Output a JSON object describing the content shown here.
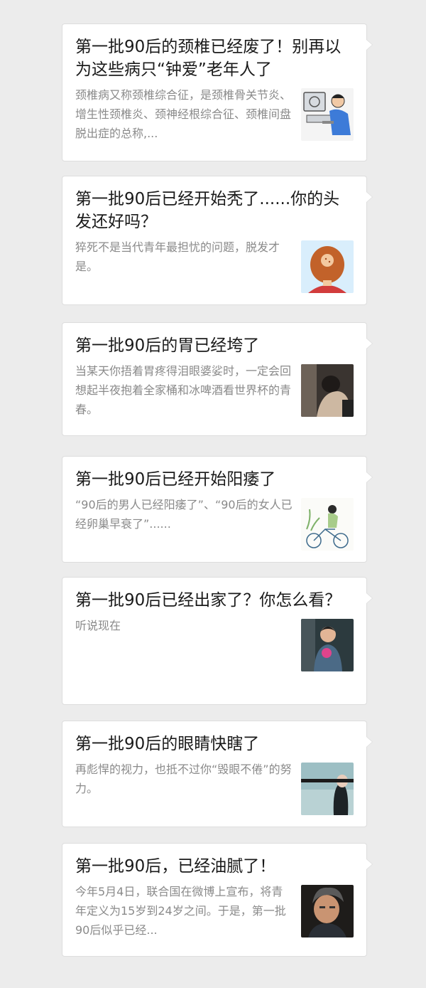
{
  "articles": [
    {
      "title": "第一批90后的颈椎已经废了！别再以为这些病只“钟爱”老年人了",
      "desc": "颈椎病又称颈椎综合征，是颈椎骨关节炎、增生性颈椎炎、颈神经根综合征、颈椎间盘脱出症的总称,...",
      "thumb_icon": "man-at-computer-illustration"
    },
    {
      "title": "第一批90后已经开始秃了......你的头发还好吗？",
      "desc": "猝死不是当代青年最担忧的问题，脱发才是。",
      "thumb_icon": "balding-head-illustration"
    },
    {
      "title": "第一批90后的胃已经垮了",
      "desc": "当某天你捂着胃疼得泪眼婆娑时，一定会回想起半夜抱着全家桶和冰啤酒看世界杯的青春。",
      "thumb_icon": "crying-person-photo"
    },
    {
      "title": "第一批90后已经开始阳痿了",
      "desc": "“90后的男人已经阳痿了”、“90后的女人已经卵巢早衰了”......",
      "thumb_icon": "cyclist-illustration"
    },
    {
      "title": "第一批90后已经出家了？你怎么看？",
      "desc": "听说现在",
      "thumb_icon": "woman-with-flower-photo"
    },
    {
      "title": "第一批90后的眼睛快瞎了",
      "desc": "再彪悍的视力，也抵不过你“毁眼不倦”的努力。",
      "thumb_icon": "blindfolded-person-photo"
    },
    {
      "title": "第一批90后，已经油腻了！",
      "desc": "今年5月4日，联合国在微博上宣布，将青年定义为15岁到24岁之间。于是，第一批90后似乎已经...",
      "thumb_icon": "middle-aged-man-photo"
    }
  ]
}
